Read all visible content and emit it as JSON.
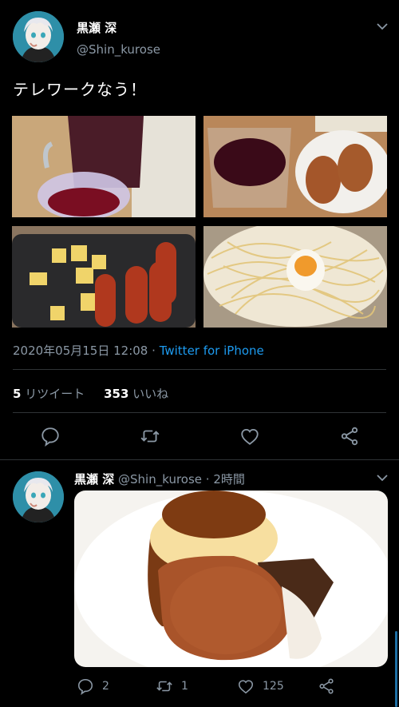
{
  "main_tweet": {
    "display_name": "黒瀬 深",
    "handle": "@Shin_kurose",
    "text": "テレワークなう！",
    "timestamp": "2020年05月15日 12:08",
    "separator": "·",
    "source": "Twitter for iPhone",
    "retweet_count": "5",
    "retweet_label": "リツイート",
    "like_count": "353",
    "like_label": "いいね",
    "icons": [
      "reply-icon",
      "retweet-icon",
      "like-icon",
      "share-icon",
      "chevron-down-icon"
    ]
  },
  "reply_tweet": {
    "display_name": "黒瀬 深",
    "handle": "@Shin_kurose",
    "time_ago": "· 2時間",
    "reply_count": "2",
    "retweet_count": "1",
    "like_count": "125"
  },
  "colors": {
    "background": "#000000",
    "secondary_text": "#8b98a5",
    "link": "#1d9bf0",
    "divider": "#2f3336"
  }
}
